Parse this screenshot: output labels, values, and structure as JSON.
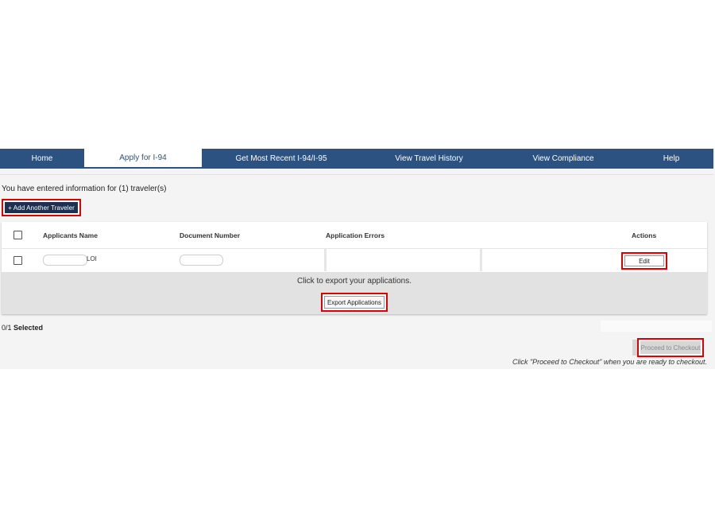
{
  "nav": {
    "tabs": [
      {
        "label": "Home",
        "active": false
      },
      {
        "label": "Apply for I-94",
        "active": true
      },
      {
        "label": "Get Most Recent I-94/I-95",
        "active": false
      },
      {
        "label": "View Travel History",
        "active": false
      },
      {
        "label": "View Compliance",
        "active": false
      },
      {
        "label": "Help",
        "active": false
      }
    ]
  },
  "info_text": "You have entered information for (1) traveler(s)",
  "add_traveler_label": "+ Add Another Traveler",
  "table": {
    "headers": {
      "name": "Applicants Name",
      "document": "Document Number",
      "errors": "Application Errors",
      "actions": "Actions"
    },
    "rows": [
      {
        "name_suffix": "LOI",
        "edit_label": "Edit"
      }
    ]
  },
  "export": {
    "prompt": "Click to export your applications.",
    "button_label": "Export Applications"
  },
  "selection": {
    "count": "0/1",
    "label": "Selected"
  },
  "checkout": {
    "button_label": "Proceed to Checkout",
    "note": "Click \"Proceed to Checkout\" when you are ready to checkout."
  },
  "colors": {
    "nav_bg": "#2c5282",
    "highlight": "#e00000",
    "add_btn_bg": "#1f2f4f"
  }
}
